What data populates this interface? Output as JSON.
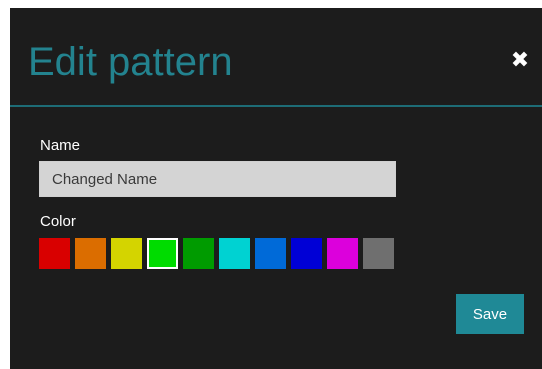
{
  "dialog": {
    "title": "Edit pattern",
    "close_glyph": "✖",
    "close_icon": "close-icon",
    "name_label": "Name",
    "name_value": "Changed Name",
    "color_label": "Color",
    "save_label": "Save",
    "colors": {
      "title": "#23838f",
      "background": "#1c1c1c",
      "divider": "#1d6c76",
      "save_button": "#1f8996"
    }
  },
  "swatches": [
    {
      "name": "red",
      "color": "#d90000",
      "selected": false
    },
    {
      "name": "orange",
      "color": "#db6d00",
      "selected": false
    },
    {
      "name": "yellow",
      "color": "#d4d400",
      "selected": false
    },
    {
      "name": "green",
      "color": "#00dc00",
      "selected": true
    },
    {
      "name": "dark-green",
      "color": "#009b00",
      "selected": false
    },
    {
      "name": "cyan",
      "color": "#00d2d2",
      "selected": false
    },
    {
      "name": "azure",
      "color": "#006ad8",
      "selected": false
    },
    {
      "name": "blue",
      "color": "#0000d6",
      "selected": false
    },
    {
      "name": "magenta",
      "color": "#dc00dc",
      "selected": false
    },
    {
      "name": "gray",
      "color": "#6f6f6f",
      "selected": false
    }
  ]
}
